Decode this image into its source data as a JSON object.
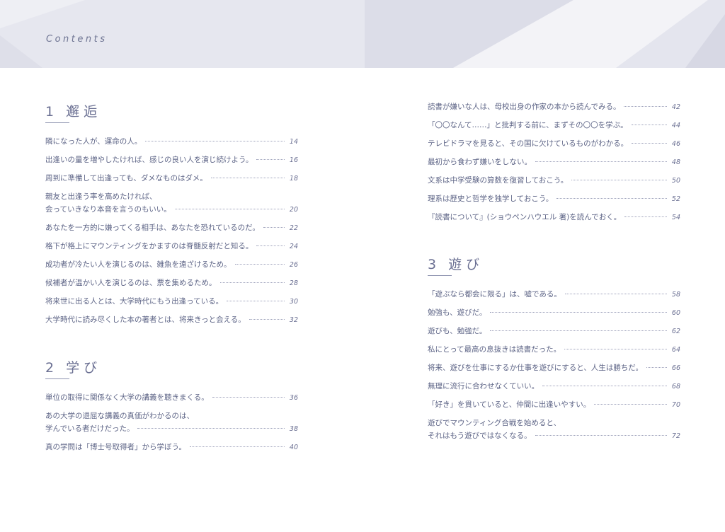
{
  "header": {
    "title": "Contents"
  },
  "sections": [
    {
      "number": "1",
      "title": "邂逅",
      "entries": [
        {
          "lines": [
            "隣になった人が、運命の人。"
          ],
          "page": "14"
        },
        {
          "lines": [
            "出逢いの量を増やしたければ、感じの良い人を演じ続けよう。"
          ],
          "page": "16"
        },
        {
          "lines": [
            "周到に準備して出逢っても、ダメなものはダメ。"
          ],
          "page": "18"
        },
        {
          "lines": [
            "親友と出逢う率を高めたければ、",
            "会っていきなり本音を言うのもいい。"
          ],
          "page": "20"
        },
        {
          "lines": [
            "あなたを一方的に嫌ってくる相手は、あなたを恐れているのだ。"
          ],
          "page": "22"
        },
        {
          "lines": [
            "格下が格上にマウンティングをかますのは脊髄反射だと知る。"
          ],
          "page": "24"
        },
        {
          "lines": [
            "成功者が冷たい人を演じるのは、雑魚を遠ざけるため。"
          ],
          "page": "26"
        },
        {
          "lines": [
            "候補者が温かい人を演じるのは、票を集めるため。"
          ],
          "page": "28"
        },
        {
          "lines": [
            "将来世に出る人とは、大学時代にもう出逢っている。"
          ],
          "page": "30"
        },
        {
          "lines": [
            "大学時代に読み尽くした本の著者とは、将来きっと会える。"
          ],
          "page": "32"
        }
      ]
    },
    {
      "number": "2",
      "title": "学び",
      "entries": [
        {
          "lines": [
            "単位の取得に関係なく大学の講義を聴きまくる。"
          ],
          "page": "36"
        },
        {
          "lines": [
            "あの大学の退屈な講義の真価がわかるのは、",
            "学んでいる者だけだった。"
          ],
          "page": "38"
        },
        {
          "lines": [
            "真の学問は「博士号取得者」から学ぼう。"
          ],
          "page": "40"
        },
        {
          "lines": [
            "読書が嫌いな人は、母校出身の作家の本から読んでみる。"
          ],
          "page": "42"
        },
        {
          "lines": [
            "「〇〇なんて……」と批判する前に、まずその〇〇を学ぶ。"
          ],
          "page": "44"
        },
        {
          "lines": [
            "テレビドラマを見ると、その国に欠けているものがわかる。"
          ],
          "page": "46"
        },
        {
          "lines": [
            "最初から食わず嫌いをしない。"
          ],
          "page": "48"
        },
        {
          "lines": [
            "文系は中学受験の算数を復習しておこう。"
          ],
          "page": "50"
        },
        {
          "lines": [
            "理系は歴史と哲学を独学しておこう。"
          ],
          "page": "52"
        },
        {
          "lines": [
            "『読書について』(ショウペンハウエル 著)を読んでおく。"
          ],
          "page": "54"
        }
      ]
    },
    {
      "number": "3",
      "title": "遊び",
      "entries": [
        {
          "lines": [
            "「遊ぶなら都会に限る」は、嘘である。"
          ],
          "page": "58"
        },
        {
          "lines": [
            "勉強も、遊びだ。"
          ],
          "page": "60"
        },
        {
          "lines": [
            "遊びも、勉強だ。"
          ],
          "page": "62"
        },
        {
          "lines": [
            "私にとって最高の息抜きは読書だった。"
          ],
          "page": "64"
        },
        {
          "lines": [
            "将来、遊びを仕事にするか仕事を遊びにすると、人生は勝ちだ。"
          ],
          "page": "66"
        },
        {
          "lines": [
            "無理に流行に合わせなくていい。"
          ],
          "page": "68"
        },
        {
          "lines": [
            "「好き」を貫いていると、仲間に出逢いやすい。"
          ],
          "page": "70"
        },
        {
          "lines": [
            "遊びでマウンティング合戦を始めると、",
            "それはもう遊びではなくなる。"
          ],
          "page": "72"
        }
      ]
    }
  ]
}
